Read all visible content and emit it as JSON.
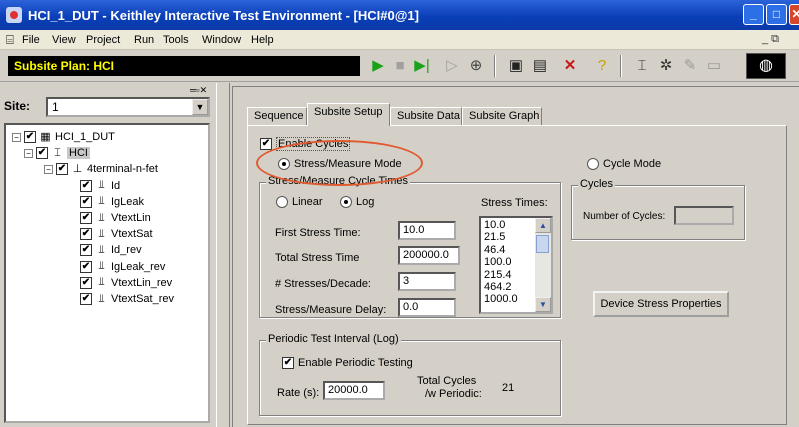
{
  "window": {
    "title": "HCI_1_DUT - Keithley Interactive Test Environment - [HCI#0@1]",
    "min_glyph": "_",
    "max_glyph": "□",
    "close_glyph": "✕"
  },
  "menu": {
    "items": [
      "File",
      "View",
      "Project",
      "Run",
      "Tools",
      "Window",
      "Help"
    ],
    "mdi_controls": "_ ⧉"
  },
  "toolbar": {
    "subsite_plan": "Subsite Plan: HCI",
    "icons": [
      "run-icon",
      "stop-icon",
      "run-step-icon",
      "step-icon",
      "globe-icon",
      "save-icon",
      "save-all-icon",
      "delete-icon",
      "help-icon",
      "config-icon",
      "gear-icon",
      "edit-icon",
      "doc-icon",
      "keithley-logo-icon"
    ],
    "colors": {
      "plan_bg": "#000000",
      "plan_text": "#ffff00",
      "run": "#1aa31a"
    }
  },
  "left_panel": {
    "site_label": "Site:",
    "site_value": "1",
    "tree": [
      {
        "label": "HCI_1_DUT",
        "level": 0,
        "expander": "⊟",
        "checked": true,
        "icon": "device-icon"
      },
      {
        "label": "HCI",
        "level": 1,
        "expander": "⊟",
        "checked": true,
        "icon": "subsite-icon",
        "selected": true
      },
      {
        "label": "4terminal-n-fet",
        "level": 2,
        "expander": "⊟",
        "checked": true,
        "icon": "transistor-icon"
      },
      {
        "label": "Id",
        "level": 3,
        "checked": true,
        "icon": "test-icon"
      },
      {
        "label": "IgLeak",
        "level": 3,
        "checked": true,
        "icon": "test-icon"
      },
      {
        "label": "VtextLin",
        "level": 3,
        "checked": true,
        "icon": "test-icon"
      },
      {
        "label": "VtextSat",
        "level": 3,
        "checked": true,
        "icon": "test-icon"
      },
      {
        "label": "Id_rev",
        "level": 3,
        "checked": true,
        "icon": "test-icon"
      },
      {
        "label": "IgLeak_rev",
        "level": 3,
        "checked": true,
        "icon": "test-icon"
      },
      {
        "label": "VtextLin_rev",
        "level": 3,
        "checked": true,
        "icon": "test-icon"
      },
      {
        "label": "VtextSat_rev",
        "level": 3,
        "checked": true,
        "icon": "test-icon"
      }
    ]
  },
  "tabs": [
    "Sequence",
    "Subsite Setup",
    "Subsite Data",
    "Subsite Graph"
  ],
  "active_tab": "Subsite Setup",
  "setup": {
    "enable_cycles": {
      "label": "Enable Cycles",
      "checked": true
    },
    "mode_stress": {
      "label": "Stress/Measure Mode",
      "selected": true
    },
    "mode_cycle": {
      "label": "Cycle Mode",
      "selected": false
    },
    "cycle_times": {
      "legend": "Stress/Measure Cycle Times",
      "linear": "Linear",
      "log": "Log",
      "log_selected": true,
      "first_stress_label": "First Stress Time:",
      "first_stress_value": "10.0",
      "total_stress_label": "Total Stress Time",
      "total_stress_value": "200000.0",
      "stresses_decade_label": "# Stresses/Decade:",
      "stresses_decade_value": "3",
      "delay_label": "Stress/Measure Delay:",
      "delay_value": "0.0",
      "stress_times_label": "Stress Times:",
      "stress_times": [
        "10.0",
        "21.5",
        "46.4",
        "100.0",
        "215.4",
        "464.2",
        "1000.0"
      ]
    },
    "cycles": {
      "legend": "Cycles",
      "number_label": "Number of Cycles:",
      "number_value": ""
    },
    "device_stress_button": "Device Stress Properties",
    "periodic": {
      "legend": "Periodic Test Interval (Log)",
      "enable_label": "Enable Periodic Testing",
      "enable_checked": true,
      "rate_label": "Rate (s):",
      "rate_value": "20000.0",
      "total_cycles_label_1": "Total Cycles",
      "total_cycles_label_2": "/w Periodic:",
      "total_cycles_value": "21"
    }
  },
  "annotation_color": "#e05a30"
}
